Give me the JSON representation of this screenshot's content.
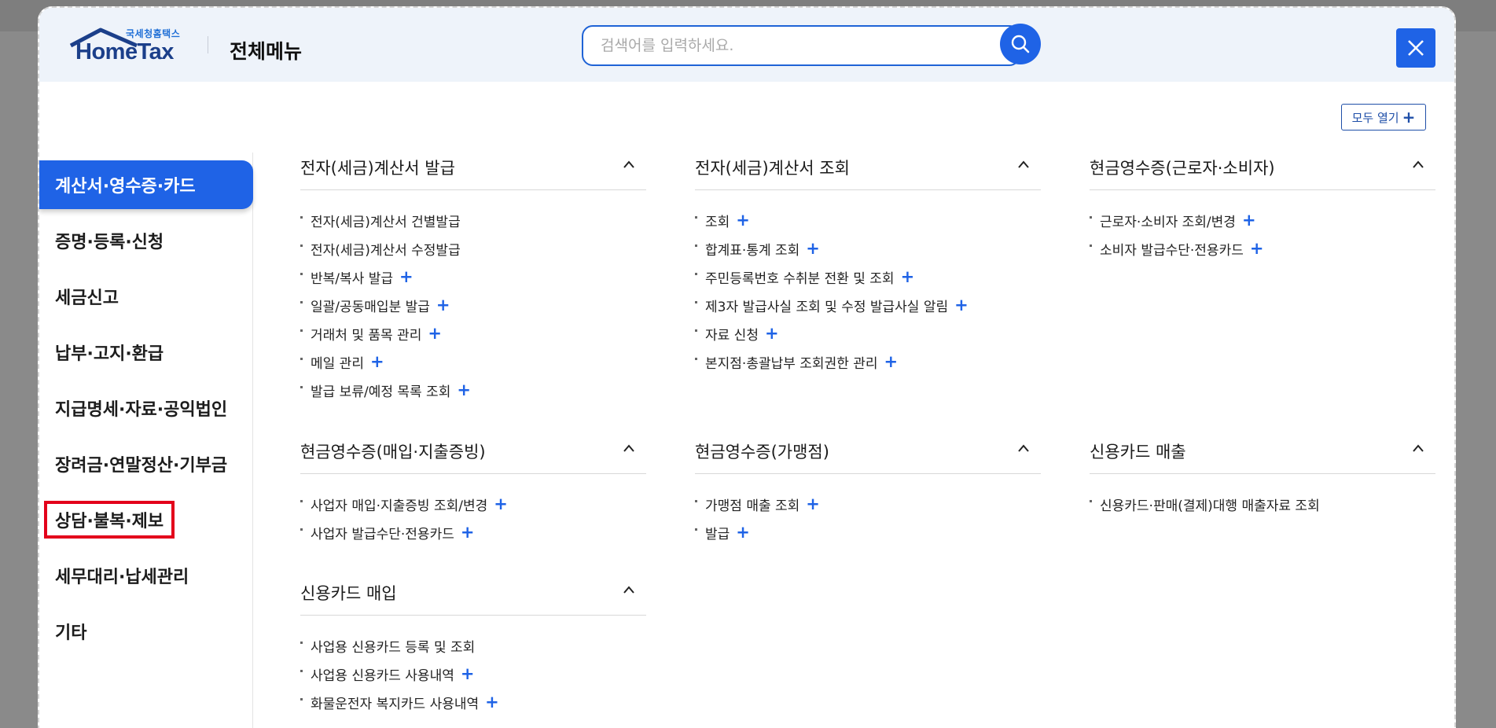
{
  "header": {
    "logo_small": "국세청홈택스",
    "logo_text": "HomeTax",
    "title": "전체메뉴",
    "search_placeholder": "검색어를 입력하세요."
  },
  "toolbar": {
    "open_all_label": "모두 열기"
  },
  "sidebar": {
    "items": [
      {
        "label": "계산서·영수증·카드",
        "active": true
      },
      {
        "label": "증명·등록·신청"
      },
      {
        "label": "세금신고"
      },
      {
        "label": "납부·고지·환급"
      },
      {
        "label": "지급명세·자료·공익법인"
      },
      {
        "label": "장려금·연말정산·기부금"
      },
      {
        "label": "상담·불복·제보",
        "highlighted": true
      },
      {
        "label": "세무대리·납세관리"
      },
      {
        "label": "기타"
      }
    ]
  },
  "sections": [
    {
      "title": "전자(세금)계산서 발급",
      "items": [
        {
          "label": "전자(세금)계산서 건별발급",
          "plus": false
        },
        {
          "label": "전자(세금)계산서 수정발급",
          "plus": false
        },
        {
          "label": "반복/복사 발급",
          "plus": true
        },
        {
          "label": "일괄/공동매입분 발급",
          "plus": true
        },
        {
          "label": "거래처 및 품목 관리",
          "plus": true
        },
        {
          "label": "메일 관리",
          "plus": true
        },
        {
          "label": "발급 보류/예정 목록 조회",
          "plus": true
        }
      ]
    },
    {
      "title": "전자(세금)계산서 조회",
      "items": [
        {
          "label": "조회",
          "plus": true
        },
        {
          "label": "합계표·통계 조회",
          "plus": true
        },
        {
          "label": "주민등록번호 수취분 전환 및 조회",
          "plus": true
        },
        {
          "label": "제3자 발급사실 조회 및 수정 발급사실 알림",
          "plus": true
        },
        {
          "label": "자료 신청",
          "plus": true
        },
        {
          "label": "본지점·총괄납부 조회권한 관리",
          "plus": true
        }
      ]
    },
    {
      "title": "현금영수증(근로자·소비자)",
      "items": [
        {
          "label": "근로자·소비자 조회/변경",
          "plus": true
        },
        {
          "label": "소비자 발급수단·전용카드",
          "plus": true
        }
      ]
    },
    {
      "title": "현금영수증(매입·지출증빙)",
      "items": [
        {
          "label": "사업자 매입·지출증빙 조회/변경",
          "plus": true
        },
        {
          "label": "사업자 발급수단·전용카드",
          "plus": true
        }
      ]
    },
    {
      "title": "현금영수증(가맹점)",
      "items": [
        {
          "label": "가맹점 매출 조회",
          "plus": true
        },
        {
          "label": "발급",
          "plus": true
        }
      ]
    },
    {
      "title": "신용카드 매출",
      "items": [
        {
          "label": "신용카드·판매(결제)대행 매출자료 조회",
          "plus": false
        }
      ]
    },
    {
      "title": "신용카드 매입",
      "items": [
        {
          "label": "사업용 신용카드 등록 및 조회",
          "plus": false
        },
        {
          "label": "사업용 신용카드 사용내역",
          "plus": true
        },
        {
          "label": "화물운전자 복지카드 사용내역",
          "plus": true
        }
      ]
    }
  ],
  "colors": {
    "accent": "#1f63e6",
    "highlight": "#e3001b",
    "header_bg": "#eef3fa"
  }
}
